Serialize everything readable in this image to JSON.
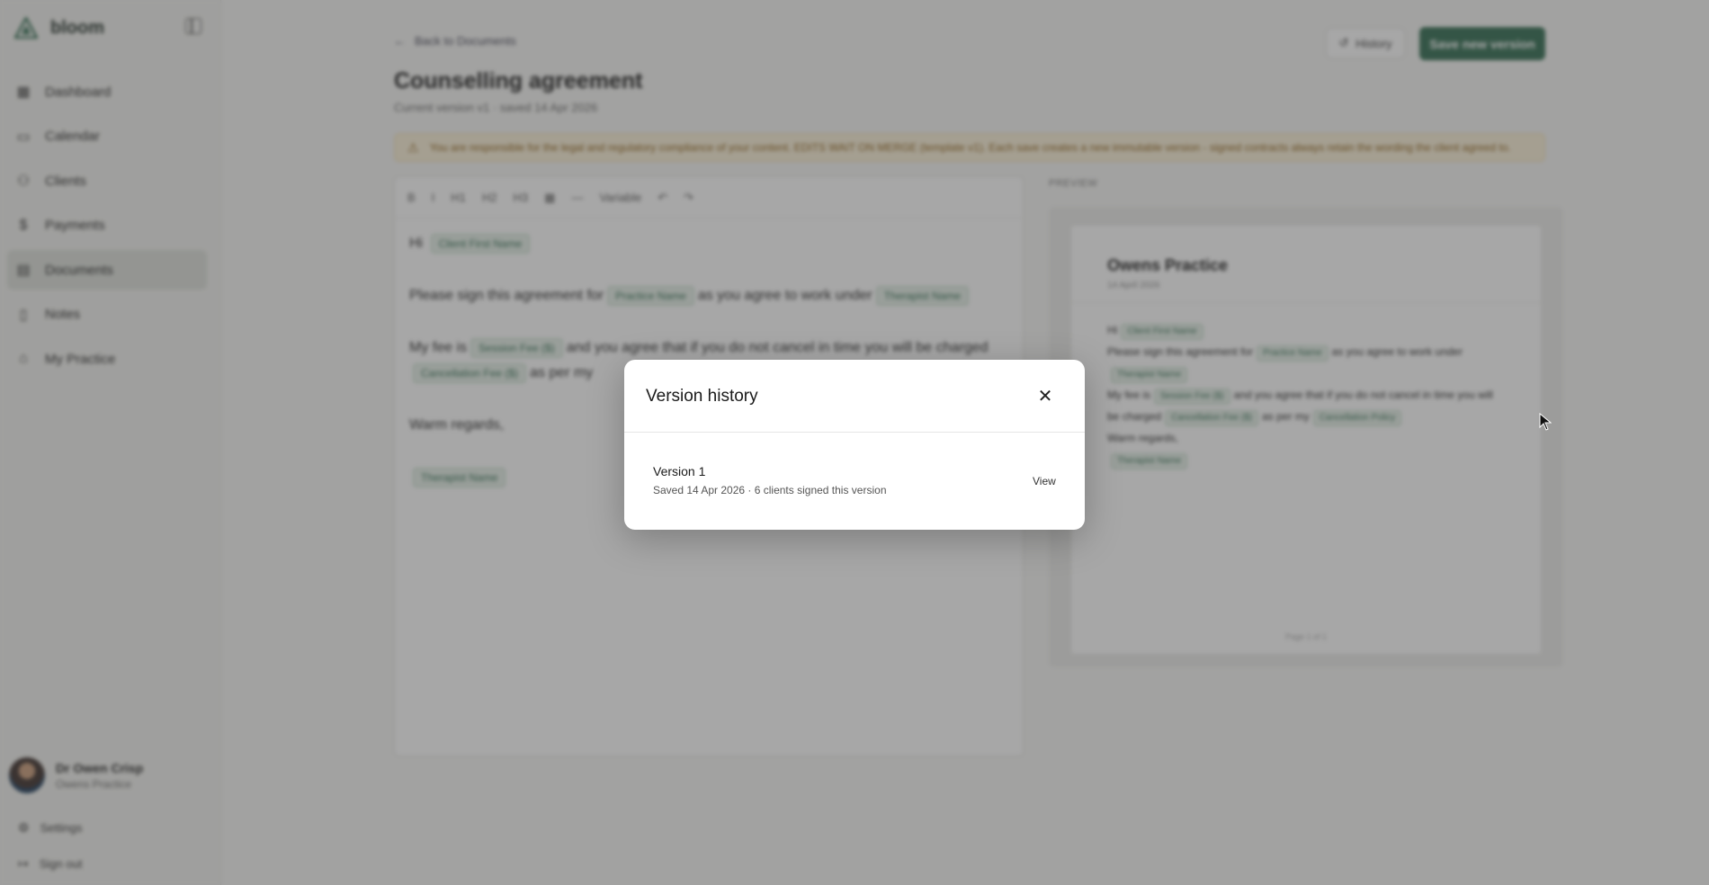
{
  "app": {
    "brand": "bloom"
  },
  "sidebar": {
    "items": [
      {
        "label": "Dashboard",
        "icon": "grid-icon"
      },
      {
        "label": "Calendar",
        "icon": "calendar-icon"
      },
      {
        "label": "Clients",
        "icon": "users-icon"
      },
      {
        "label": "Payments",
        "icon": "dollar-icon"
      },
      {
        "label": "Documents",
        "icon": "document-icon",
        "active": true
      },
      {
        "label": "Notes",
        "icon": "notes-icon"
      },
      {
        "label": "My Practice",
        "icon": "building-icon"
      }
    ],
    "profile": {
      "name": "Dr Owen Crisp",
      "org": "Owens Practice"
    },
    "settings": "Settings",
    "signout": "Sign out"
  },
  "main": {
    "back": "Back to Documents",
    "title": "Counselling agreement",
    "subtitle": "Current version v1 · saved 14 Apr 2026",
    "history_btn": "History",
    "save_btn": "Save new version",
    "warning": "You are responsible for the legal and regulatory compliance of your content. EDITS WAIT ON MERGE (template v1). Each save creates a new immutable version - signed contracts always retain the wording the client agreed to."
  },
  "editor": {
    "toolbar": [
      "B",
      "I",
      "H1",
      "H2",
      "H3",
      "▦",
      "—",
      "Variable",
      "↶",
      "↷"
    ],
    "hi": "Hi",
    "client_first_name": "Client First Name",
    "line1_a": "Please sign this agreement for",
    "practice_name": "Practice Name",
    "line1_b": "as you agree to work under",
    "therapist_name": "Therapist Name",
    "line2_a": "My fee is",
    "session_fee": "Session Fee ($)",
    "line2_b": "and you agree that if you do not cancel in time you will be",
    "line2_c": "charged",
    "cancellation_fee": "Cancellation Fee ($)",
    "line2_d": "as per my",
    "cancellation_policy": "Cancellation Policy",
    "regards": "Warm regards,"
  },
  "preview": {
    "label": "PREVIEW",
    "title": "Owens Practice",
    "sub": "14 April 2026",
    "footer": "Page 1 of 1"
  },
  "modal": {
    "title": "Version history",
    "version_name": "Version 1",
    "version_meta": "Saved 14 Apr 2026 · 6 clients signed this version",
    "view": "View"
  }
}
